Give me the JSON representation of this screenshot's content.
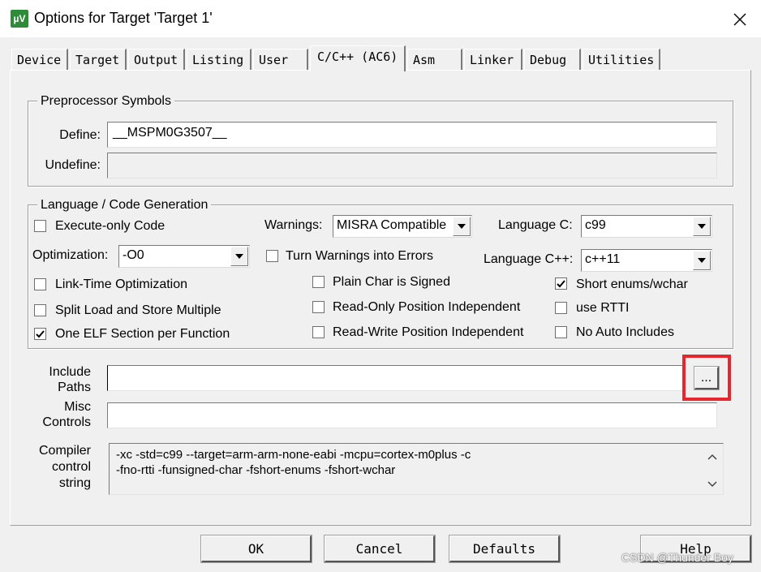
{
  "window": {
    "icon_text": "µV",
    "title": "Options for Target 'Target 1'"
  },
  "tabs": [
    {
      "label": "Device"
    },
    {
      "label": "Target"
    },
    {
      "label": "Output"
    },
    {
      "label": "Listing"
    },
    {
      "label": "User"
    },
    {
      "label": "C/C++ (AC6)"
    },
    {
      "label": "Asm"
    },
    {
      "label": "Linker"
    },
    {
      "label": "Debug"
    },
    {
      "label": "Utilities"
    }
  ],
  "active_tab": "C/C++ (AC6)",
  "preprocessor": {
    "group_label": "Preprocessor Symbols",
    "define_label": "Define:",
    "define_value": "__MSPM0G3507__",
    "undefine_label": "Undefine:",
    "undefine_value": ""
  },
  "language": {
    "group_label": "Language / Code Generation",
    "execute_only": {
      "label": "Execute-only Code",
      "checked": false
    },
    "warnings_label": "Warnings:",
    "warnings_value": "MISRA Compatible",
    "language_c_label": "Language C:",
    "language_c_value": "c99",
    "optimization_label": "Optimization:",
    "optimization_value": "-O0",
    "turn_warnings": {
      "label": "Turn Warnings into Errors",
      "checked": false
    },
    "language_cpp_label": "Language C++:",
    "language_cpp_value": "c++11",
    "lto": {
      "label": "Link-Time Optimization",
      "checked": false
    },
    "plain_char": {
      "label": "Plain Char is Signed",
      "checked": false
    },
    "short_enums": {
      "label": "Short enums/wchar",
      "checked": true
    },
    "split_load": {
      "label": "Split Load and Store Multiple",
      "checked": false
    },
    "ropi": {
      "label": "Read-Only Position Independent",
      "checked": false
    },
    "rtti": {
      "label": "use RTTI",
      "checked": false
    },
    "one_elf": {
      "label": "One ELF Section per Function",
      "checked": true
    },
    "rwpi": {
      "label": "Read-Write Position Independent",
      "checked": false
    },
    "no_auto_includes": {
      "label": "No Auto Includes",
      "checked": false
    }
  },
  "include_paths": {
    "label_line1": "Include",
    "label_line2": "Paths",
    "value": "",
    "browse_label": "..."
  },
  "misc_controls": {
    "label_line1": "Misc",
    "label_line2": "Controls",
    "value": ""
  },
  "compiler_string": {
    "label_line1": "Compiler",
    "label_line2": "control",
    "label_line3": "string",
    "line1": "-xc -std=c99 --target=arm-arm-none-eabi -mcpu=cortex-m0plus -c",
    "line2": "-fno-rtti -funsigned-char -fshort-enums -fshort-wchar"
  },
  "buttons": {
    "ok": "OK",
    "cancel": "Cancel",
    "defaults": "Defaults",
    "help": "Help"
  },
  "watermark": "CSDN @Thunder Boy",
  "colors": {
    "highlight": "#e8262d",
    "app_icon": "#2e8b3a"
  }
}
